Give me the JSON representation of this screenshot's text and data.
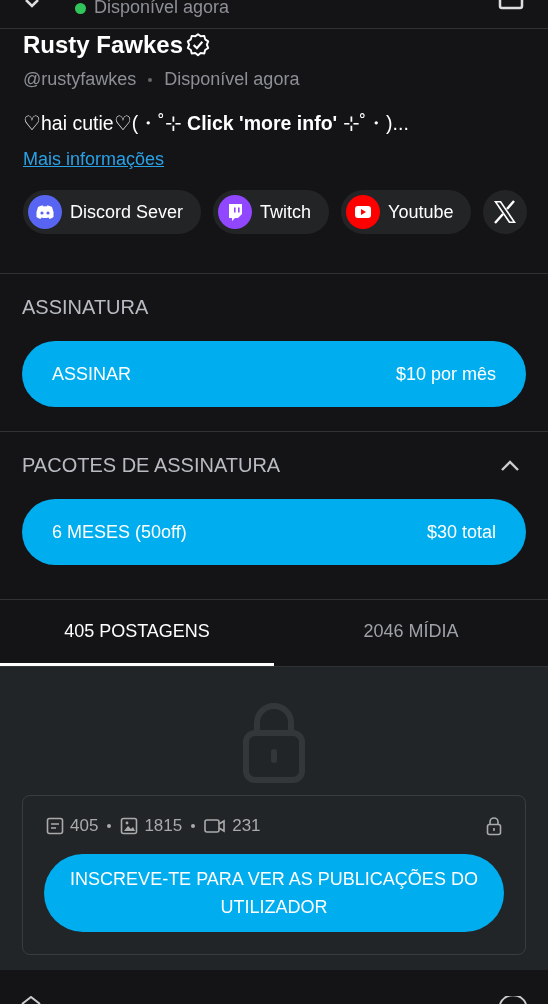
{
  "header": {
    "status": "Disponível agora",
    "online": true
  },
  "profile": {
    "name": "Rusty Fawkes",
    "verified": true,
    "handle": "@rustyfawkes",
    "availability": "Disponível agora",
    "bio": "♡hai cutie♡(・˚⊹ **Click 'more info'** ⊹˚・)...",
    "more_link": "Mais informações"
  },
  "links": [
    {
      "kind": "discord",
      "label": "Discord Sever"
    },
    {
      "kind": "twitch",
      "label": "Twitch"
    },
    {
      "kind": "youtube",
      "label": "Youtube"
    },
    {
      "kind": "x"
    }
  ],
  "subscription": {
    "heading": "ASSINATURA",
    "button": {
      "label": "ASSINAR",
      "price": "$10 por mês"
    }
  },
  "bundles": {
    "heading": "PACOTES DE ASSINATURA",
    "expanded": true,
    "items": [
      {
        "label": "6 MESES (50off)",
        "price": "$30 total"
      }
    ]
  },
  "tabs": [
    {
      "label": "405 POSTAGENS",
      "selected": true
    },
    {
      "label": "2046 MÍDIA",
      "selected": false
    }
  ],
  "locked": {
    "counts": [
      {
        "kind": "posts",
        "value": "405"
      },
      {
        "kind": "images",
        "value": "1815"
      },
      {
        "kind": "videos",
        "value": "231"
      }
    ],
    "button": "INSCREVE-TE PARA VER AS PUBLICAÇÕES DO UTILIZADOR"
  }
}
